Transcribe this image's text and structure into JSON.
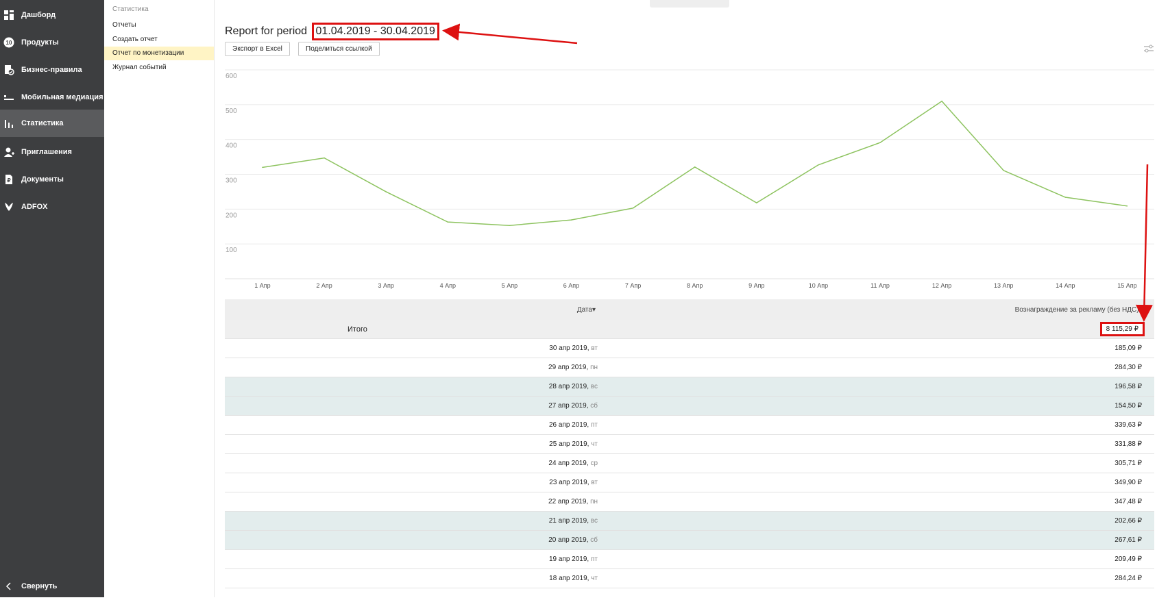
{
  "nav": {
    "items": [
      {
        "label": "Дашборд",
        "icon": "dashboard-icon"
      },
      {
        "label": "Продукты",
        "icon": "products-icon"
      },
      {
        "label": "Бизнес-правила",
        "icon": "business-rules-icon"
      },
      {
        "label": "Мобильная медиация",
        "icon": "mediation-icon"
      },
      {
        "label": "Статистика",
        "icon": "bar-chart-icon",
        "active": true
      },
      {
        "label": "Приглашения",
        "icon": "add-user-icon"
      },
      {
        "label": "Документы",
        "icon": "document-icon"
      },
      {
        "label": "ADFOX",
        "icon": "adfox-icon"
      }
    ],
    "collapse_label": "Свернуть"
  },
  "submenu": {
    "title": "Статистика",
    "items": [
      {
        "label": "Отчеты"
      },
      {
        "label": "Создать отчет"
      },
      {
        "label": "Отчет по монетизации",
        "active": true
      },
      {
        "label": "Журнал событий"
      }
    ]
  },
  "report": {
    "title_prefix": "Report for period",
    "period": "01.04.2019 - 30.04.2019",
    "export_label": "Экспорт в Excel",
    "share_label": "Поделиться ссылкой"
  },
  "colors": {
    "line": "#8dc35f",
    "annotation": "#d11111",
    "nav_bg": "#3d3e40",
    "active_sub": "#fff4c5",
    "weekend_row": "#e3eded"
  },
  "chart_data": {
    "type": "line",
    "categories": [
      "1 Апр",
      "2 Апр",
      "3 Апр",
      "4 Апр",
      "5 Апр",
      "6 Апр",
      "7 Апр",
      "8 Апр",
      "9 Апр",
      "10 Апр",
      "11 Апр",
      "12 Апр",
      "13 Апр",
      "14 Апр",
      "15 Апр"
    ],
    "series": [
      {
        "values": [
          320,
          347,
          250,
          163,
          153,
          169,
          203,
          321,
          218,
          327,
          391,
          510,
          311,
          234,
          209
        ]
      }
    ],
    "yticks": [
      100,
      200,
      300,
      400,
      500,
      600
    ],
    "ylim": [
      0,
      600
    ],
    "grid": true,
    "legend": "none"
  },
  "table": {
    "columns": [
      "Дата",
      "Вознаграждение за рекламу (без НДС)"
    ],
    "total": {
      "label": "Итого",
      "value": "8 115,29 ₽"
    },
    "rows": [
      {
        "date": "30 апр 2019,",
        "wd": "вт",
        "value": "185,09 ₽",
        "weekend": false
      },
      {
        "date": "29 апр 2019,",
        "wd": "пн",
        "value": "284,30 ₽",
        "weekend": false
      },
      {
        "date": "28 апр 2019,",
        "wd": "вс",
        "value": "196,58 ₽",
        "weekend": true
      },
      {
        "date": "27 апр 2019,",
        "wd": "сб",
        "value": "154,50 ₽",
        "weekend": true
      },
      {
        "date": "26 апр 2019,",
        "wd": "пт",
        "value": "339,63 ₽",
        "weekend": false
      },
      {
        "date": "25 апр 2019,",
        "wd": "чт",
        "value": "331,88 ₽",
        "weekend": false
      },
      {
        "date": "24 апр 2019,",
        "wd": "ср",
        "value": "305,71 ₽",
        "weekend": false
      },
      {
        "date": "23 апр 2019,",
        "wd": "вт",
        "value": "349,90 ₽",
        "weekend": false
      },
      {
        "date": "22 апр 2019,",
        "wd": "пн",
        "value": "347,48 ₽",
        "weekend": false
      },
      {
        "date": "21 апр 2019,",
        "wd": "вс",
        "value": "202,66 ₽",
        "weekend": true
      },
      {
        "date": "20 апр 2019,",
        "wd": "сб",
        "value": "267,61 ₽",
        "weekend": true
      },
      {
        "date": "19 апр 2019,",
        "wd": "пт",
        "value": "209,49 ₽",
        "weekend": false
      },
      {
        "date": "18 апр 2019,",
        "wd": "чт",
        "value": "284,24 ₽",
        "weekend": false
      }
    ]
  }
}
